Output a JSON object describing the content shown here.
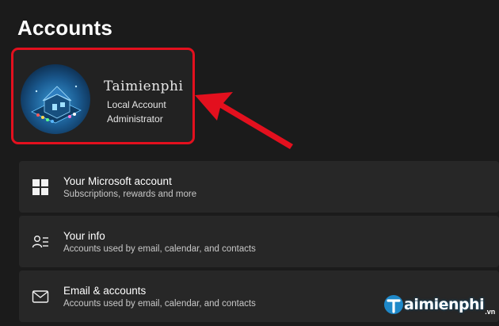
{
  "page": {
    "title": "Accounts"
  },
  "profile": {
    "name": "Taimienphi",
    "account_type": "Local Account",
    "role": "Administrator"
  },
  "rows": [
    {
      "title": "Your Microsoft account",
      "subtitle": "Subscriptions, rewards and more",
      "icon": "windows-logo-icon"
    },
    {
      "title": "Your info",
      "subtitle": "Accounts used by email, calendar, and contacts",
      "icon": "person-info-icon"
    },
    {
      "title": "Email & accounts",
      "subtitle": "Accounts used by email, calendar, and contacts",
      "icon": "envelope-icon"
    }
  ],
  "watermark": {
    "text": "aimienphi",
    "tld": ".vn"
  },
  "colors": {
    "background": "#1b1b1b",
    "row": "#272727",
    "highlight": "#e3101e",
    "brand": "#1e88c8"
  }
}
